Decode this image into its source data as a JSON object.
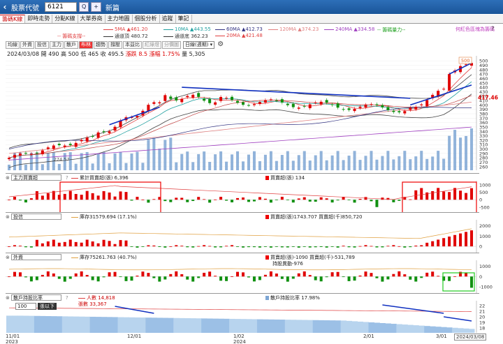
{
  "topbar": {
    "title": "股票代號",
    "code": "6121",
    "search_btn": "Q",
    "plus_btn": "+",
    "new_window": "新篇"
  },
  "tabs": [
    "籌碼K線",
    "即時走勢",
    "分點K線",
    "大單券商",
    "主力地圖",
    "個股分析",
    "追蹤",
    "筆記"
  ],
  "legend": {
    "ma5": "5MA ▲461.20",
    "ma10": "10MA ▲443.55",
    "ma60": "60MA ▲412.73",
    "ma120": "120MA ▲374.23",
    "ma240": "240MA ▲334.58",
    "energy": "-- 籌碼量力--",
    "qmark": "?",
    "pressure": "-- 籌碼支撐--",
    "top": "通道頂 480.72",
    "bottom": "通道底 362.23",
    "ma20": "20MA ▲421.48",
    "hint": "何紅色區塊為籌碼"
  },
  "colors": {
    "ma5": "#e04040",
    "ma10": "#20a0a0",
    "ma60": "#303080",
    "ma120": "#e08080",
    "ma240": "#a040c0",
    "up": "#e00000",
    "down": "#109010",
    "vol": "#7ea6d4",
    "arrow": "#1030c0"
  },
  "toolbar": {
    "items": [
      "均線",
      "外資",
      "投信",
      "主力",
      "散戶",
      "布林",
      "趨勢",
      "撐壓",
      "本益比",
      "紅綠燈",
      "分價圖"
    ],
    "active": "布林",
    "period": "日線(週期)"
  },
  "quote": {
    "date": "2024/03/08",
    "open_label": "開",
    "open": "490",
    "high_label": "高",
    "high": "500",
    "low_label": "低",
    "low": "465",
    "close_label": "收",
    "close": "495.5",
    "chg": "漲跌 8.5",
    "pct": "漲幅 1.75%",
    "vol": "量 5,305"
  },
  "price_panel": {
    "ticks": [
      "500",
      "490",
      "480",
      "470",
      "460",
      "450",
      "440",
      "430",
      "420",
      "410",
      "400",
      "390",
      "380",
      "370",
      "360",
      "350",
      "340",
      "330",
      "320",
      "310",
      "300",
      "290",
      "280",
      "270",
      "260"
    ],
    "last": "417.46",
    "peak": "500",
    "low_label": "274.57"
  },
  "panels": [
    {
      "name": "主力買賣超",
      "line": "累計買賣超(張) 6,396",
      "bar": "買賣超(張) 134",
      "ticks": [
        "1000",
        "500",
        "0",
        "-500"
      ]
    },
    {
      "name": "投信",
      "line": "庫存31579.694 (17.1%)",
      "bar": "買賣超(張)1743.707 買賣超(千)850,720",
      "ticks": [
        "2000",
        "1000",
        "0"
      ]
    },
    {
      "name": "外資",
      "line": "庫存75261.763 (40.7%)",
      "bar": "買賣超(張)-1090 買賣超(千)-531,789",
      "bar2": "持股異動-976",
      "ticks": [
        "1000",
        "0",
        "-1000"
      ]
    },
    {
      "name": "散戶持股比率",
      "line": "人數 14,818",
      "line2": "張數 33,367",
      "bar": "散戶持股比率 17.98%",
      "ticks": [
        "22",
        "21",
        "20",
        "19",
        "18"
      ],
      "dropdown": "100",
      "dropdown_label": "張以下"
    }
  ],
  "xaxis": [
    {
      "d": "11/01",
      "y": "2023"
    },
    {
      "d": "12/01",
      "y": ""
    },
    {
      "d": "1/02",
      "y": "2024"
    },
    {
      "d": "2/01",
      "y": ""
    },
    {
      "d": "3/01",
      "y": ""
    },
    {
      "d": "2024/03/08",
      "y": ""
    }
  ]
}
